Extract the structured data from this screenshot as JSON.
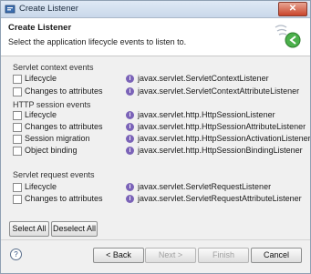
{
  "window": {
    "title": "Create Listener",
    "close_glyph": "✕"
  },
  "header": {
    "title": "Create Listener",
    "description": "Select the application lifecycle events to listen to.",
    "banner_icon": "wizard-banner-icon"
  },
  "groups": [
    {
      "label": "Servlet context events",
      "rows": [
        {
          "label": "Lifecycle",
          "checked": false,
          "class": "javax.servlet.ServletContextListener"
        },
        {
          "label": "Changes to attributes",
          "checked": false,
          "class": "javax.servlet.ServletContextAttributeListener"
        }
      ]
    },
    {
      "label": "HTTP session events",
      "rows": [
        {
          "label": "Lifecycle",
          "checked": false,
          "class": "javax.servlet.http.HttpSessionListener"
        },
        {
          "label": "Changes to attributes",
          "checked": false,
          "class": "javax.servlet.http.HttpSessionAttributeListener"
        },
        {
          "label": "Session migration",
          "checked": false,
          "class": "javax.servlet.http.HttpSessionActivationListener"
        },
        {
          "label": "Object binding",
          "checked": false,
          "class": "javax.servlet.http.HttpSessionBindingListener"
        }
      ]
    },
    {
      "label": "Servlet request events",
      "rows": [
        {
          "label": "Lifecycle",
          "checked": false,
          "class": "javax.servlet.ServletRequestListener"
        },
        {
          "label": "Changes to attributes",
          "checked": false,
          "class": "javax.servlet.ServletRequestAttributeListener"
        }
      ]
    }
  ],
  "interface_icon_glyph": "I",
  "selection_buttons": {
    "select_all": "Select All",
    "deselect_all": "Deselect All"
  },
  "footer": {
    "help_glyph": "?",
    "back": "< Back",
    "next": "Next >",
    "finish": "Finish",
    "cancel": "Cancel"
  }
}
